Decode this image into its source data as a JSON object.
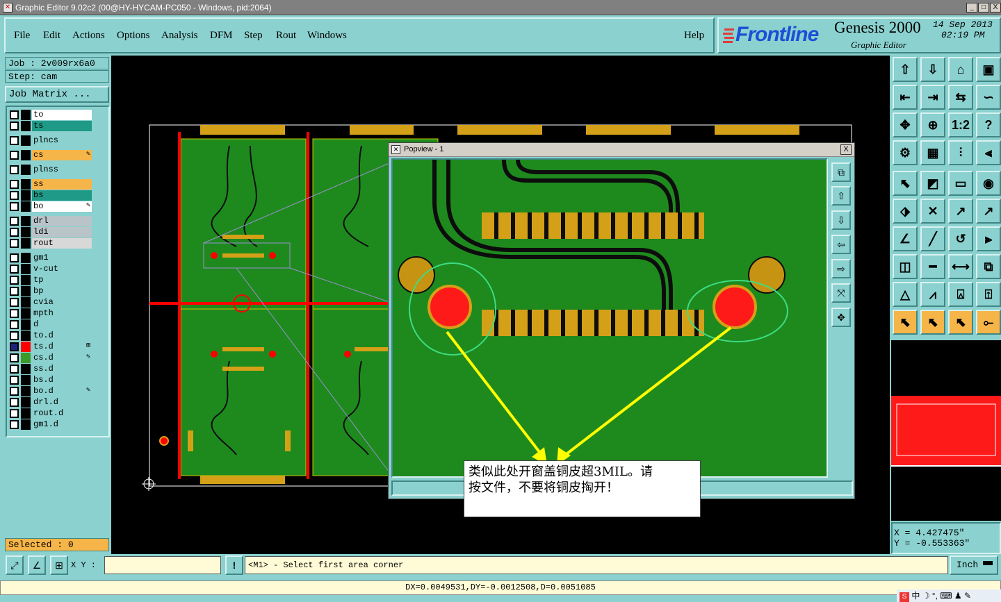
{
  "window": {
    "title": "Graphic Editor 9.02c2 (00@HY-HYCAM-PC050 - Windows, pid:2064)",
    "min": "_",
    "max": "□",
    "close": "X"
  },
  "menubar": {
    "items": [
      "File",
      "Edit",
      "Actions",
      "Options",
      "Analysis",
      "DFM",
      "Step",
      "Rout",
      "Windows"
    ],
    "help": "Help"
  },
  "brand": {
    "logo": "Frontline",
    "product": "Genesis 2000",
    "subtitle": "Graphic Editor",
    "date": "14 Sep 2013",
    "time": "02:19 PM"
  },
  "job": {
    "job_label": "Job : 2v009rx6a0",
    "step_label": "Step: cam",
    "matrix_button": "Job Matrix ..."
  },
  "layers": [
    {
      "name": "to",
      "color": "#ffffff"
    },
    {
      "name": "ts",
      "color": "#1f9a88"
    },
    {
      "name": "plncs",
      "color": "#8ad1cf"
    },
    {
      "name": "cs",
      "color": "#f6b548",
      "mark": "✎"
    },
    {
      "name": "plnss",
      "color": "#8ad1cf"
    },
    {
      "name": "ss",
      "color": "#f6b548"
    },
    {
      "name": "bs",
      "color": "#1f9a88"
    },
    {
      "name": "bo",
      "color": "#ffffff",
      "mark": "✎"
    },
    {
      "name": "drl",
      "color": "#b8c4c8"
    },
    {
      "name": "ldi",
      "color": "#b8c4c8"
    },
    {
      "name": "rout",
      "color": "#d8d8d8"
    },
    {
      "name": "gm1",
      "color": "#8ad1cf"
    },
    {
      "name": "v-cut",
      "color": "#8ad1cf"
    },
    {
      "name": "tp",
      "color": "#8ad1cf"
    },
    {
      "name": "bp",
      "color": "#8ad1cf"
    },
    {
      "name": "cvia",
      "color": "#8ad1cf"
    },
    {
      "name": "mpth",
      "color": "#8ad1cf"
    },
    {
      "name": "d",
      "color": "#8ad1cf"
    },
    {
      "name": "to.d",
      "color": "#8ad1cf"
    },
    {
      "name": "ts.d",
      "color": "#8ad1cf",
      "swatch": "#ff0000",
      "mark": "⊞"
    },
    {
      "name": "cs.d",
      "color": "#8ad1cf",
      "swatch": "#3c9a28",
      "mark": "✎"
    },
    {
      "name": "ss.d",
      "color": "#8ad1cf"
    },
    {
      "name": "bs.d",
      "color": "#8ad1cf"
    },
    {
      "name": "bo.d",
      "color": "#8ad1cf",
      "mark": "✎"
    },
    {
      "name": "drl.d",
      "color": "#8ad1cf"
    },
    {
      "name": "rout.d",
      "color": "#8ad1cf"
    },
    {
      "name": "gm1.d",
      "color": "#8ad1cf"
    }
  ],
  "selected": "Selected : 0",
  "popview": {
    "title": "Popview - 1",
    "close": "X"
  },
  "annotation": {
    "line1": "类似此处开窗盖铜皮超3MIL。请",
    "line2": "按文件，不要将铜皮掏开！"
  },
  "coords": {
    "x": "X = 4.427475\"",
    "y": "Y = -0.553363\""
  },
  "command": {
    "xy_label": "X Y :",
    "xy_value": "",
    "prompt": "<M1> - Select first area corner",
    "units": "Inch"
  },
  "status": "DX=0.0049531,DY=-0.0012508,D=0.0051085",
  "tray": {
    "ime": "中"
  },
  "colors": {
    "panel": "#8ad1cf",
    "board": "#1e8a1e",
    "pad": "#d4a017",
    "hole": "#ff0000",
    "note_arrow": "#ffff00",
    "circle": "#3ddc84"
  }
}
